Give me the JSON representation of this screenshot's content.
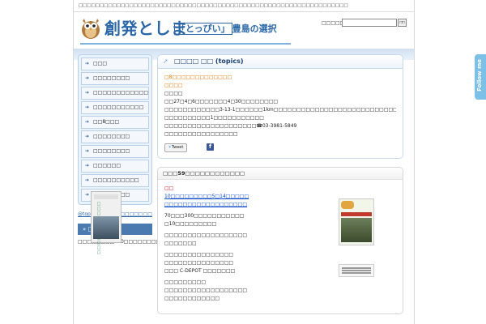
{
  "topbar": {
    "text": "□□□□□□□□□□□□□□□□□□□□□□□□□□□□□□□□□□□□□□□□□□□□□□□□□□□□□□□□□□□□□□□□"
  },
  "header": {
    "title": "創発としま",
    "subtitle_bracket": "「とっぴい」",
    "subtitle_rest": "豊島の選択",
    "search_label": "□□□□□□□",
    "search_placeholder": "",
    "search_button": "□□"
  },
  "sidebar": {
    "items": [
      {
        "label": "□□□"
      },
      {
        "label": "□□□□□□□□"
      },
      {
        "label": "□□□□□□□□□□□□□□□□"
      },
      {
        "label": "□□□□□□□□□□□"
      },
      {
        "label": "□□8□□□"
      },
      {
        "label": "□□□□□□□□"
      },
      {
        "label": "□□□□□□□□"
      },
      {
        "label": "□□□□□□"
      },
      {
        "label": "□□□□□□□□□□"
      },
      {
        "label": "□□□□□□□□"
      }
    ],
    "twitter_link": "@toppy_toshima □□□□□□□",
    "book_heading": "□□□□□□",
    "book_text": "□□□□□□□□220□□□□□□□□□□□□□□□□□",
    "book_cover_title": "□□□□□□□□□□□"
  },
  "topics": {
    "heading": "□□□□ □□ (topics)",
    "lines": [
      {
        "text": "□8□□□□□□□□□□□□□",
        "style": "orange"
      },
      {
        "text": "□□□□",
        "style": "orange"
      },
      {
        "text": "□□□□",
        "style": ""
      },
      {
        "text": "□□27□4□6□□□□□□□4□30□□□□□□□□",
        "style": ""
      },
      {
        "text": "□□□□□□□□□□□□3-13-1□□□□□□1km□□□□□□□□□□□□□□□□□□□□□□□□□□□□□□□□□□□□□□□",
        "style": ""
      },
      {
        "text": "□□□□□□□□□□1□□□□□□□□□□□",
        "style": ""
      },
      {
        "text": "□□□□□□□□□□□□□□□□□□□□☎03-3981-5849",
        "style": ""
      },
      {
        "text": "□□□□□□□□□□□□□□□□",
        "style": ""
      }
    ],
    "tweet_label": "Tweet"
  },
  "issue": {
    "heading": "□□□59□□□□□□□□□□□□",
    "red_line": "□□",
    "link1": "10□□□□□□□□□5□14□□□□□",
    "link2": "□□□□□□□□□□□□□□□□□□",
    "paras": [
      "70□□□300□□□□□□□□□□□",
      "□10□□□□□□□□□",
      "",
      "□□□□□□□□□□□□□□□□□□",
      "□□□□□□□",
      "",
      "□□□□□□□□□□□□□□□",
      "□□□□□□□□□□□□□□□",
      "□□□ C-DEPOT □□□□□□□",
      "",
      "□□□□□□□□□",
      "□□□□□□□□□□□□□□□□□□",
      "□□□□□□□□□□□□"
    ]
  },
  "followme": {
    "label": "Follow me"
  }
}
